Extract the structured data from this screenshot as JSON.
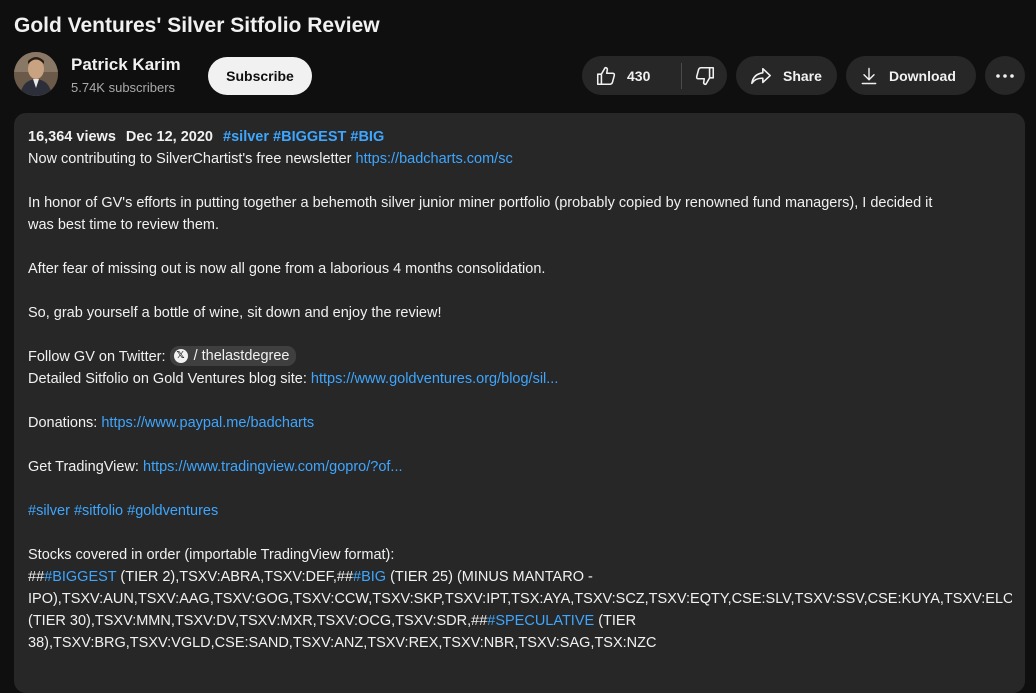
{
  "video": {
    "title": "Gold Ventures' Silver Sitfolio Review"
  },
  "channel": {
    "name": "Patrick Karim",
    "subscribers": "5.74K subscribers",
    "subscribe_label": "Subscribe"
  },
  "actions": {
    "like_count": "430",
    "share_label": "Share",
    "download_label": "Download"
  },
  "description": {
    "views": "16,364 views",
    "date": "Dec 12, 2020",
    "tags": [
      "#silver",
      "#BIGGEST",
      "#BIG"
    ],
    "line1_text": "Now contributing to SilverChartist's free newsletter ",
    "line1_link": "https://badcharts.com/sc",
    "para2_line1": "In honor of GV's efforts in putting together a behemoth silver junior miner portfolio (probably copied by renowned fund managers), I decided it",
    "para2_line2": "was best time to review them.",
    "para3": "After fear of missing out is now all gone from a laborious 4 months consolidation.",
    "para4": "So, grab yourself a bottle of wine, sit down and enjoy the review!",
    "twitter_label": "Follow GV on Twitter: ",
    "twitter_chip_x": "𝕏",
    "twitter_chip_text": "/ thelastdegree",
    "blog_label": "Detailed Sitfolio on Gold Ventures blog site: ",
    "blog_link": "https://www.goldventures.org/blog/sil...",
    "donations_label": "Donations: ",
    "donations_link": "https://www.paypal.me/badcharts",
    "tradingview_label": "Get TradingView: ",
    "tradingview_link": "https://www.tradingview.com/gopro/?of...",
    "hashtags": [
      "#silver",
      "#sitfolio",
      "#goldventures"
    ],
    "stocks_heading": "Stocks covered in order (importable TradingView format):",
    "stocks_l1_a": "##",
    "stocks_l1_tag1": "#BIGGEST",
    "stocks_l1_b": " (TIER 2),TSXV:ABRA,TSXV:DEF,##",
    "stocks_l1_tag2": "#BIG",
    "stocks_l1_c": " (TIER 25) (MINUS MANTARO -",
    "stocks_l2": "IPO),TSXV:AUN,TSXV:AAG,TSXV:GOG,TSXV:CCW,TSXV:SKP,TSXV:IPT,TSX:AYA,TSXV:SCZ,TSXV:EQTY,CSE:SLV,TSXV:SSV,CSE:KUYA,TSXV:ELO,TSXV:",
    "stocks_l3_a": "(TIER 30),TSXV:MMN,TSXV:DV,TSXV:MXR,TSXV:OCG,TSXV:SDR,##",
    "stocks_l3_tag": "#SPECULATIVE",
    "stocks_l3_b": " (TIER",
    "stocks_l4": "38),TSXV:BRG,TSXV:VGLD,CSE:SAND,TSXV:ANZ,TSXV:REX,TSXV:NBR,TSXV:SAG,TSX:NZC"
  },
  "icons": {
    "like": "thumbs-up-icon",
    "dislike": "thumbs-down-icon",
    "share": "share-arrow-icon",
    "download": "download-icon",
    "more": "more-horizontal-icon"
  }
}
